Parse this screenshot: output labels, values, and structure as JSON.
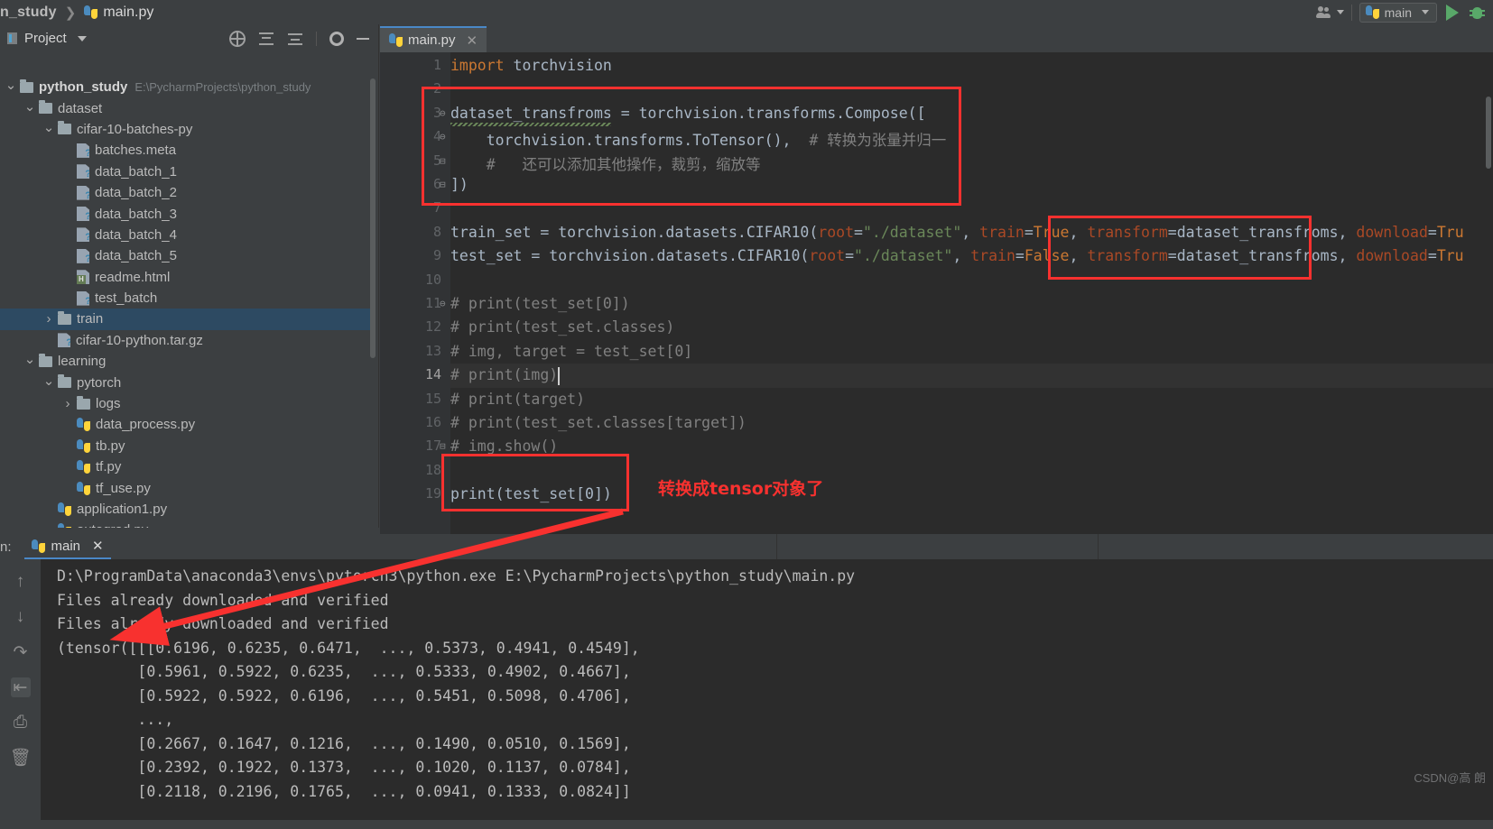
{
  "window": {
    "breadcrumb_project": "n_study",
    "breadcrumb_file": "main.py",
    "run_config_name": "main",
    "watermark": "CSDN@高 朗"
  },
  "project_panel": {
    "title": "Project",
    "icons": [
      "locate-icon",
      "expand-all-icon",
      "collapse-all-icon",
      "settings-gear-icon",
      "hide-panel-icon"
    ],
    "tree": [
      {
        "label": "python_study",
        "path": "E:\\PycharmProjects\\python_study",
        "type": "project-root",
        "indent": 0,
        "twist": "down",
        "bold": true
      },
      {
        "label": "dataset",
        "type": "folder",
        "indent": 1,
        "twist": "down"
      },
      {
        "label": "cifar-10-batches-py",
        "type": "folder",
        "indent": 2,
        "twist": "down"
      },
      {
        "label": "batches.meta",
        "type": "unknown-file",
        "indent": 3,
        "twist": ""
      },
      {
        "label": "data_batch_1",
        "type": "unknown-file",
        "indent": 3,
        "twist": ""
      },
      {
        "label": "data_batch_2",
        "type": "unknown-file",
        "indent": 3,
        "twist": ""
      },
      {
        "label": "data_batch_3",
        "type": "unknown-file",
        "indent": 3,
        "twist": ""
      },
      {
        "label": "data_batch_4",
        "type": "unknown-file",
        "indent": 3,
        "twist": ""
      },
      {
        "label": "data_batch_5",
        "type": "unknown-file",
        "indent": 3,
        "twist": ""
      },
      {
        "label": "readme.html",
        "type": "html-file",
        "indent": 3,
        "twist": ""
      },
      {
        "label": "test_batch",
        "type": "unknown-file",
        "indent": 3,
        "twist": ""
      },
      {
        "label": "train",
        "type": "folder",
        "indent": 2,
        "twist": "right",
        "selected": true
      },
      {
        "label": "cifar-10-python.tar.gz",
        "type": "unknown-file",
        "indent": 2,
        "twist": ""
      },
      {
        "label": "learning",
        "type": "folder",
        "indent": 1,
        "twist": "down"
      },
      {
        "label": "pytorch",
        "type": "folder",
        "indent": 2,
        "twist": "down"
      },
      {
        "label": "logs",
        "type": "folder",
        "indent": 3,
        "twist": "right"
      },
      {
        "label": "data_process.py",
        "type": "python-file",
        "indent": 3,
        "twist": ""
      },
      {
        "label": "tb.py",
        "type": "python-file",
        "indent": 3,
        "twist": ""
      },
      {
        "label": "tf.py",
        "type": "python-file",
        "indent": 3,
        "twist": ""
      },
      {
        "label": "tf_use.py",
        "type": "python-file",
        "indent": 3,
        "twist": ""
      },
      {
        "label": "application1.py",
        "type": "python-file",
        "indent": 2,
        "twist": ""
      },
      {
        "label": "autograd.py",
        "type": "python-file",
        "indent": 2,
        "twist": ""
      }
    ]
  },
  "editor": {
    "tab_label": "main.py",
    "tab_close": "✕",
    "current_line": 14,
    "line_numbers": [
      1,
      2,
      3,
      4,
      5,
      6,
      7,
      8,
      9,
      10,
      11,
      12,
      13,
      14,
      15,
      16,
      17,
      18,
      19
    ],
    "lines": [
      {
        "n": 1,
        "text": "import torchvision"
      },
      {
        "n": 2,
        "text": ""
      },
      {
        "n": 3,
        "text": "dataset_transfroms = torchvision.transforms.Compose(["
      },
      {
        "n": 4,
        "text": "    torchvision.transforms.ToTensor(),  # 转换为张量并归一"
      },
      {
        "n": 5,
        "text": "    #   还可以添加其他操作，裁剪，缩放等"
      },
      {
        "n": 6,
        "text": "])"
      },
      {
        "n": 7,
        "text": ""
      },
      {
        "n": 8,
        "text": "train_set = torchvision.datasets.CIFAR10(root=\"./dataset\", train=True, transform=dataset_transfroms, download=Tru"
      },
      {
        "n": 9,
        "text": "test_set = torchvision.datasets.CIFAR10(root=\"./dataset\", train=False, transform=dataset_transfroms, download=Tru"
      },
      {
        "n": 10,
        "text": ""
      },
      {
        "n": 11,
        "text": "# print(test_set[0])"
      },
      {
        "n": 12,
        "text": "# print(test_set.classes)"
      },
      {
        "n": 13,
        "text": "# img, target = test_set[0]"
      },
      {
        "n": 14,
        "text": "# print(img)"
      },
      {
        "n": 15,
        "text": "# print(target)"
      },
      {
        "n": 16,
        "text": "# print(test_set.classes[target])"
      },
      {
        "n": 17,
        "text": "# img.show()"
      },
      {
        "n": 18,
        "text": ""
      },
      {
        "n": 19,
        "text": "print(test_set[0])"
      }
    ],
    "annotations": [
      {
        "name": "compose-block-highlight",
        "text": ""
      },
      {
        "name": "transform-arg-highlight",
        "text": ""
      },
      {
        "name": "print-statement-highlight",
        "text": ""
      }
    ],
    "annotation_note": "转换成tensor对象了"
  },
  "run_panel": {
    "label": "n:",
    "tab_name": "main",
    "tab_close": "✕",
    "tool_icons": [
      "scroll-up-icon",
      "scroll-down-icon",
      "soft-wrap-icon",
      "scroll-to-end-icon",
      "print-icon",
      "clear-all-icon"
    ],
    "console_lines": [
      "D:\\ProgramData\\anaconda3\\envs\\pytorch3\\python.exe E:\\PycharmProjects\\python_study\\main.py",
      "Files already downloaded and verified",
      "Files already downloaded and verified",
      "(tensor([[[0.6196, 0.6235, 0.6471,  ..., 0.5373, 0.4941, 0.4549],",
      "         [0.5961, 0.5922, 0.6235,  ..., 0.5333, 0.4902, 0.4667],",
      "         [0.5922, 0.5922, 0.6196,  ..., 0.5451, 0.5098, 0.4706],",
      "         ...,",
      "         [0.2667, 0.1647, 0.1216,  ..., 0.1490, 0.0510, 0.1569],",
      "         [0.2392, 0.1922, 0.1373,  ..., 0.1020, 0.1137, 0.0784],",
      "         [0.2118, 0.2196, 0.1765,  ..., 0.0941, 0.1333, 0.0824]]"
    ]
  },
  "colors": {
    "accent_blue": "#4a88c7",
    "annotation_red": "#f8312f",
    "editor_bg": "#2b2b2b",
    "panel_bg": "#3c3f41",
    "selection_blue": "#2d4a62",
    "keyword_orange": "#cc7832",
    "string_green": "#6a8759",
    "comment_gray": "#808080",
    "param_red": "#aa4926"
  }
}
